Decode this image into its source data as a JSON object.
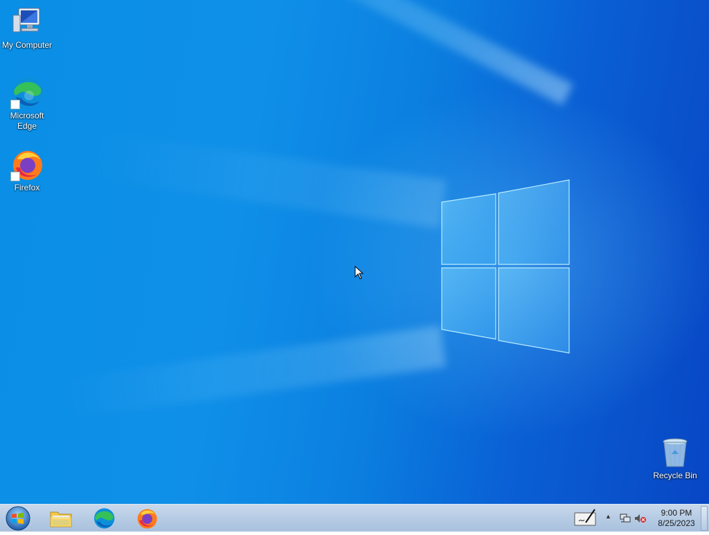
{
  "desktop": {
    "icons": [
      {
        "label": "My Computer",
        "icon": "computer-icon"
      },
      {
        "label": "Microsoft Edge",
        "icon": "edge-icon"
      },
      {
        "label": "Firefox",
        "icon": "firefox-icon"
      },
      {
        "label": "Recycle Bin",
        "icon": "recycle-bin-icon"
      }
    ],
    "colors": {
      "wallpaper_light": "#0f8fe8",
      "wallpaper_dark": "#0846c4"
    }
  },
  "taskbar": {
    "start_icon": "windows-orb-icon",
    "pinned": [
      {
        "name": "File Explorer",
        "icon": "folder-icon"
      },
      {
        "name": "Microsoft Edge",
        "icon": "edge-icon"
      },
      {
        "name": "Firefox",
        "icon": "firefox-icon"
      }
    ],
    "tray": {
      "time": "9:00 PM",
      "date": "8/25/2023",
      "icons": [
        "pen-input-icon",
        "show-hidden-icons-arrow",
        "network-icon",
        "volume-muted-icon"
      ]
    }
  }
}
